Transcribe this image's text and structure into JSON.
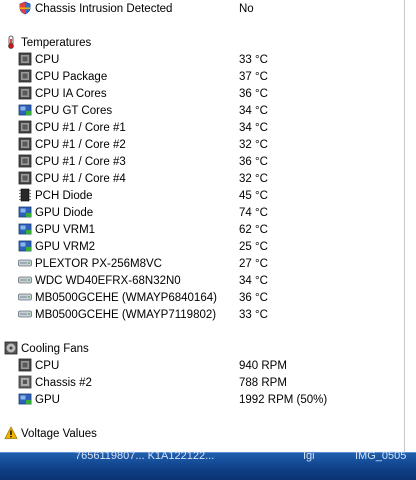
{
  "window_title_partial": "",
  "items": [
    {
      "type": "item",
      "icon": "shield-warning-icon",
      "name": "Chassis Intrusion Detected",
      "value": "No"
    },
    {
      "type": "section",
      "icon": "thermometer-icon",
      "name": "Temperatures"
    },
    {
      "type": "item",
      "icon": "cpu-chip-icon",
      "name": "CPU",
      "value": "33 °C"
    },
    {
      "type": "item",
      "icon": "cpu-chip-icon",
      "name": "CPU Package",
      "value": "37 °C"
    },
    {
      "type": "item",
      "icon": "cpu-chip-icon",
      "name": "CPU IA Cores",
      "value": "36 °C"
    },
    {
      "type": "item",
      "icon": "gpu-icon",
      "name": "CPU GT Cores",
      "value": "34 °C"
    },
    {
      "type": "item",
      "icon": "cpu-chip-icon",
      "name": "CPU #1 / Core #1",
      "value": "34 °C"
    },
    {
      "type": "item",
      "icon": "cpu-chip-icon",
      "name": "CPU #1 / Core #2",
      "value": "32 °C"
    },
    {
      "type": "item",
      "icon": "cpu-chip-icon",
      "name": "CPU #1 / Core #3",
      "value": "36 °C"
    },
    {
      "type": "item",
      "icon": "cpu-chip-icon",
      "name": "CPU #1 / Core #4",
      "value": "32 °C"
    },
    {
      "type": "item",
      "icon": "pch-chip-icon",
      "name": "PCH Diode",
      "value": "45 °C"
    },
    {
      "type": "item",
      "icon": "gpu-icon",
      "name": "GPU Diode",
      "value": "74 °C"
    },
    {
      "type": "item",
      "icon": "gpu-icon",
      "name": "GPU VRM1",
      "value": "62 °C"
    },
    {
      "type": "item",
      "icon": "gpu-icon",
      "name": "GPU VRM2",
      "value": "25 °C"
    },
    {
      "type": "item",
      "icon": "disk-icon",
      "name": "PLEXTOR PX-256M8VC",
      "value": "27 °C"
    },
    {
      "type": "item",
      "icon": "disk-icon",
      "name": "WDC WD40EFRX-68N32N0",
      "value": "34 °C"
    },
    {
      "type": "item",
      "icon": "disk-icon",
      "name": "MB0500GCEHE (WMAYP6840164)",
      "value": "36 °C"
    },
    {
      "type": "item",
      "icon": "disk-icon",
      "name": "MB0500GCEHE (WMAYP7119802)",
      "value": "33 °C"
    },
    {
      "type": "spacer"
    },
    {
      "type": "section",
      "icon": "fan-icon",
      "name": "Cooling Fans"
    },
    {
      "type": "item",
      "icon": "cpu-chip-icon",
      "name": "CPU",
      "value": "940 RPM"
    },
    {
      "type": "item",
      "icon": "fan-chip-icon",
      "name": "Chassis #2",
      "value": "788 RPM"
    },
    {
      "type": "item",
      "icon": "gpu-icon",
      "name": "GPU",
      "value": "1992 RPM  (50%)"
    },
    {
      "type": "spacer"
    },
    {
      "type": "section",
      "icon": "warning-icon",
      "name": "Voltage Values"
    }
  ],
  "taskbar": {
    "text1": "7656119807...  K1A122122...",
    "text2": "Igi",
    "text3": "IMG_0505"
  },
  "colors": {
    "taskbar": "#0e3f86",
    "warning": "#f0b400",
    "shield": "#2f6fd0"
  }
}
